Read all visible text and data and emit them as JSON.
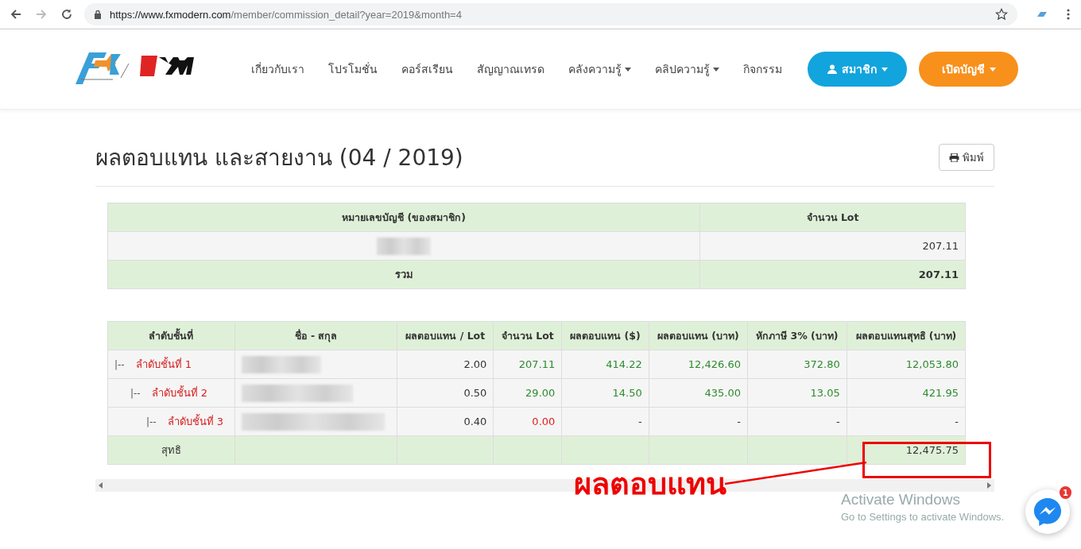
{
  "browser": {
    "url_host": "https://www.fxmodern.com",
    "url_path": "/member/commission_detail?year=2019&month=4",
    "forward_disabled": true
  },
  "nav": {
    "items": [
      {
        "label": "เกี่ยวกับเรา",
        "dropdown": false
      },
      {
        "label": "โปรโมชั่น",
        "dropdown": false
      },
      {
        "label": "คอร์สเรียน",
        "dropdown": false
      },
      {
        "label": "สัญญาณเทรด",
        "dropdown": false
      },
      {
        "label": "คลังความรู้",
        "dropdown": true
      },
      {
        "label": "คลิปความรู้",
        "dropdown": true
      },
      {
        "label": "กิจกรรม",
        "dropdown": false
      }
    ],
    "member_button": "สมาชิก",
    "open_account_button": "เปิดบัญชี"
  },
  "page": {
    "title": "ผลตอบแทน และสายงาน (04 / 2019)",
    "print_button": "พิมพ์"
  },
  "accounts_table": {
    "columns": [
      "หมายเลขบัญชี (ของสมาชิก)",
      "จำนวน Lot"
    ],
    "rows": [
      {
        "lots": "207.11"
      }
    ],
    "total": {
      "label": "รวม",
      "lots": "207.11"
    }
  },
  "tiers_table": {
    "columns": [
      "ลำดับชั้นที่",
      "ชื่อ - สกุล",
      "ผลตอบแทน / Lot",
      "จำนวน Lot",
      "ผลตอบแทน ($)",
      "ผลตอบแทน (บาท)",
      "หักภาษี 3% (บาท)",
      "ผลตอบแทนสุทธิ (บาท)"
    ],
    "tiers": [
      {
        "branch": "|--",
        "label": "ลำดับชั้นที่ 1",
        "rate": "2.00",
        "values": [
          {
            "text": "207.11",
            "color": "#2e8b2e"
          },
          {
            "text": "414.22",
            "color": "#2e8b2e"
          },
          {
            "text": "12,426.60",
            "color": "#2e8b2e"
          },
          {
            "text": "372.80",
            "color": "#2e8b2e"
          },
          {
            "text": "12,053.80",
            "color": "#2e8b2e"
          }
        ],
        "children": [
          {
            "branch": "|--",
            "label": "ลำดับชั้นที่ 2",
            "rate": "0.50",
            "values": [
              {
                "text": "29.00",
                "color": "#2e8b2e"
              },
              {
                "text": "14.50",
                "color": "#2e8b2e"
              },
              {
                "text": "435.00",
                "color": "#2e8b2e"
              },
              {
                "text": "13.05",
                "color": "#2e8b2e"
              },
              {
                "text": "421.95",
                "color": "#2e8b2e"
              }
            ],
            "children": [
              {
                "branch": "|--",
                "label": "ลำดับชั้นที่ 3",
                "rate": "0.40",
                "values": [
                  {
                    "text": "0.00",
                    "color": "#e02020"
                  },
                  {
                    "text": "-",
                    "color": "#333333"
                  },
                  {
                    "text": "-",
                    "color": "#333333"
                  },
                  {
                    "text": "-",
                    "color": "#333333"
                  },
                  {
                    "text": "-",
                    "color": "#333333"
                  }
                ]
              }
            ]
          }
        ]
      }
    ],
    "total": {
      "label": "สุทธิ",
      "net": "12,475.75"
    }
  },
  "annotation": {
    "label": "ผลตอบแทน"
  },
  "os_notice": {
    "title": "Activate Windows",
    "subtitle": "Go to Settings to activate Windows."
  },
  "chat": {
    "badge": "1"
  }
}
